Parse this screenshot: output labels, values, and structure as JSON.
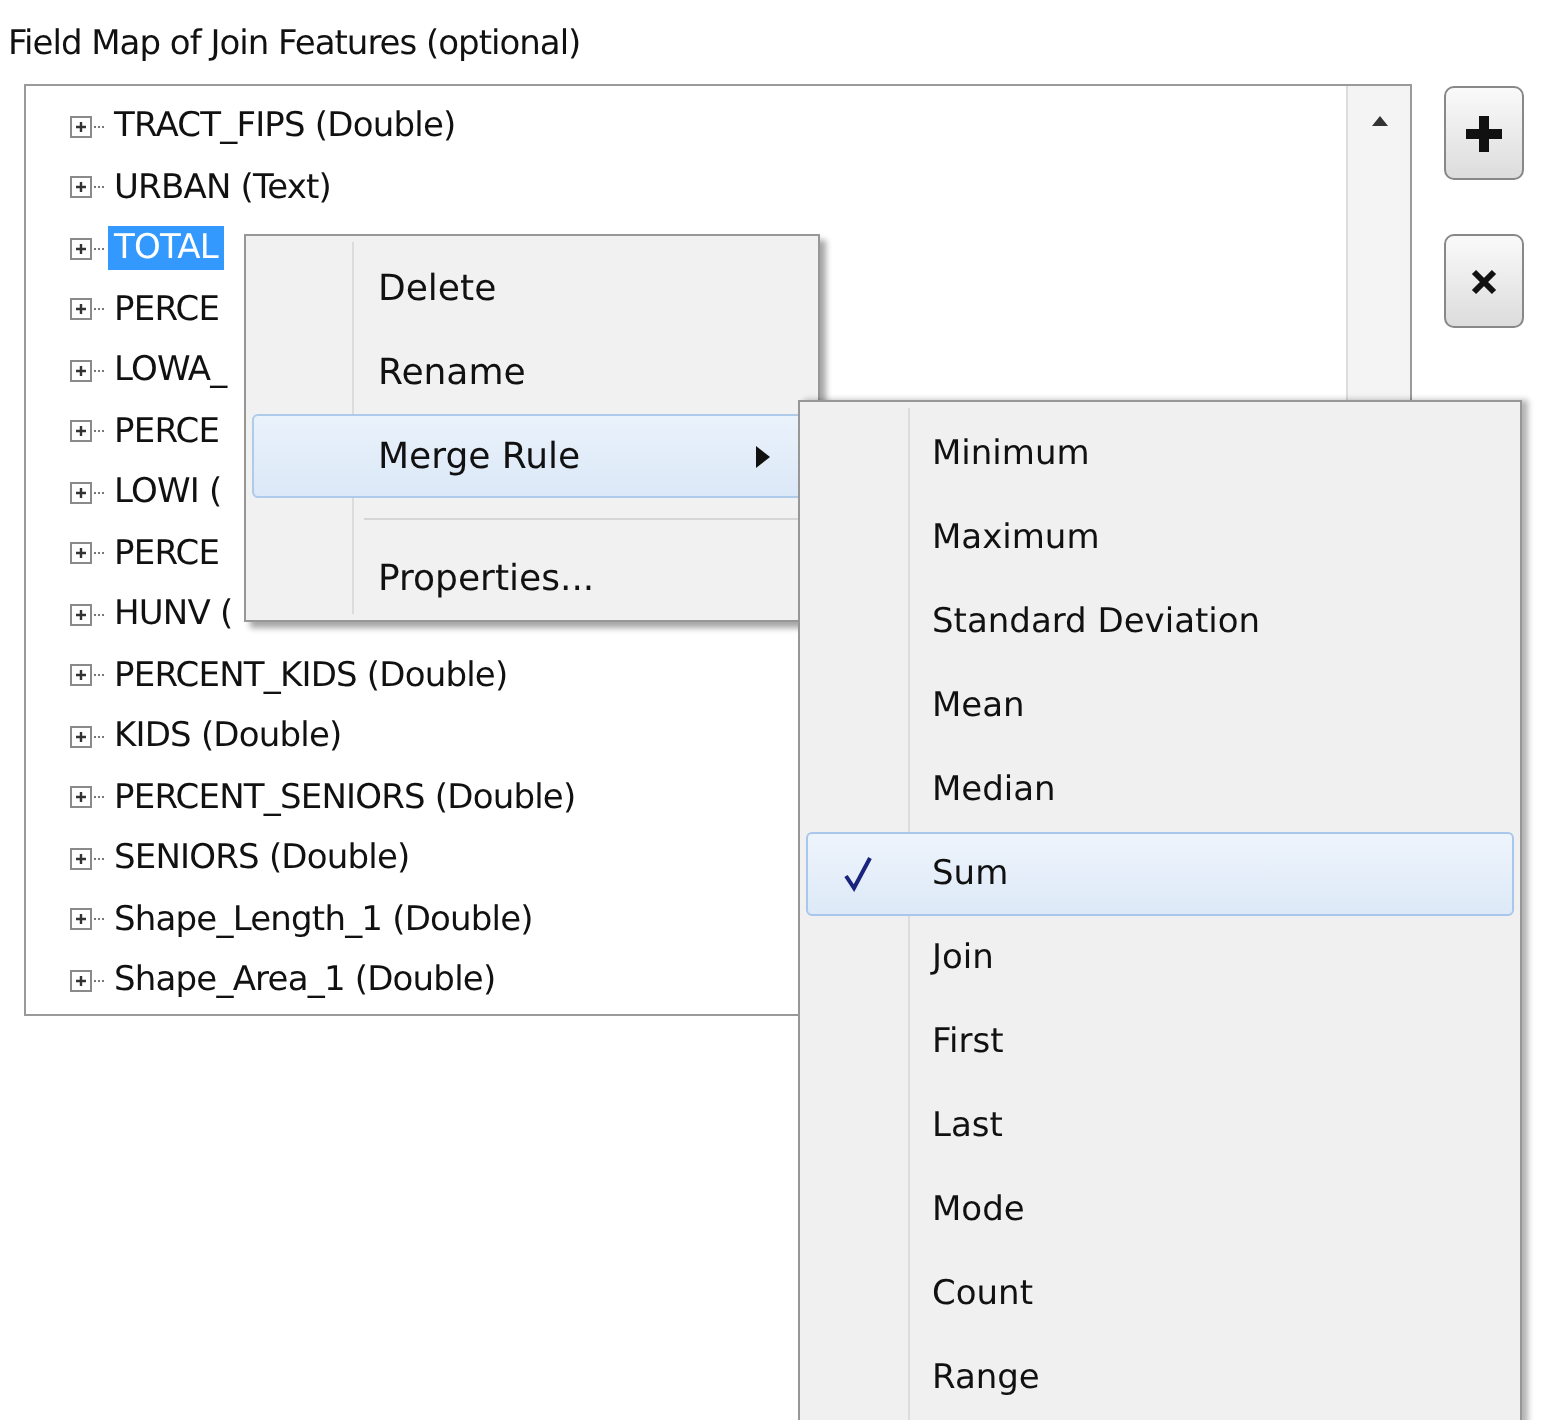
{
  "title": "Field Map of Join Features (optional)",
  "tree": {
    "rows": [
      {
        "label": "TRACT_FIPS (Double)",
        "selected": false
      },
      {
        "label": "URBAN (Text)",
        "selected": false
      },
      {
        "label": "TOTAL",
        "selected": true
      },
      {
        "label": "PERCE",
        "selected": false
      },
      {
        "label": "LOWA_",
        "selected": false
      },
      {
        "label": "PERCE",
        "selected": false
      },
      {
        "label": "LOWI (",
        "selected": false
      },
      {
        "label": "PERCE",
        "selected": false
      },
      {
        "label": "HUNV (",
        "selected": false
      },
      {
        "label": "PERCENT_KIDS (Double)",
        "selected": false
      },
      {
        "label": "KIDS (Double)",
        "selected": false
      },
      {
        "label": "PERCENT_SENIORS (Double)",
        "selected": false
      },
      {
        "label": "SENIORS (Double)",
        "selected": false
      },
      {
        "label": "Shape_Length_1 (Double)",
        "selected": false
      },
      {
        "label": "Shape_Area_1 (Double)",
        "selected": false
      }
    ]
  },
  "side_buttons": [
    {
      "kind": "add"
    },
    {
      "kind": "delete"
    }
  ],
  "context_menu": {
    "items": [
      {
        "kind": "item",
        "label": "Delete",
        "selected": false
      },
      {
        "kind": "item",
        "label": "Rename",
        "selected": false
      },
      {
        "kind": "submenu",
        "label": "Merge Rule",
        "selected": true
      },
      {
        "kind": "separator"
      },
      {
        "kind": "item",
        "label": "Properties...",
        "selected": false
      }
    ]
  },
  "merge_rule_menu": {
    "items": [
      {
        "label": "Minimum",
        "checked": false,
        "selected": false
      },
      {
        "label": "Maximum",
        "checked": false,
        "selected": false
      },
      {
        "label": "Standard Deviation",
        "checked": false,
        "selected": false
      },
      {
        "label": "Mean",
        "checked": false,
        "selected": false
      },
      {
        "label": "Median",
        "checked": false,
        "selected": false
      },
      {
        "label": "Sum",
        "checked": true,
        "selected": true
      },
      {
        "label": "Join",
        "checked": false,
        "selected": false
      },
      {
        "label": "First",
        "checked": false,
        "selected": false
      },
      {
        "label": "Last",
        "checked": false,
        "selected": false
      },
      {
        "label": "Mode",
        "checked": false,
        "selected": false
      },
      {
        "label": "Count",
        "checked": false,
        "selected": false
      },
      {
        "label": "Range",
        "checked": false,
        "selected": false
      }
    ]
  }
}
